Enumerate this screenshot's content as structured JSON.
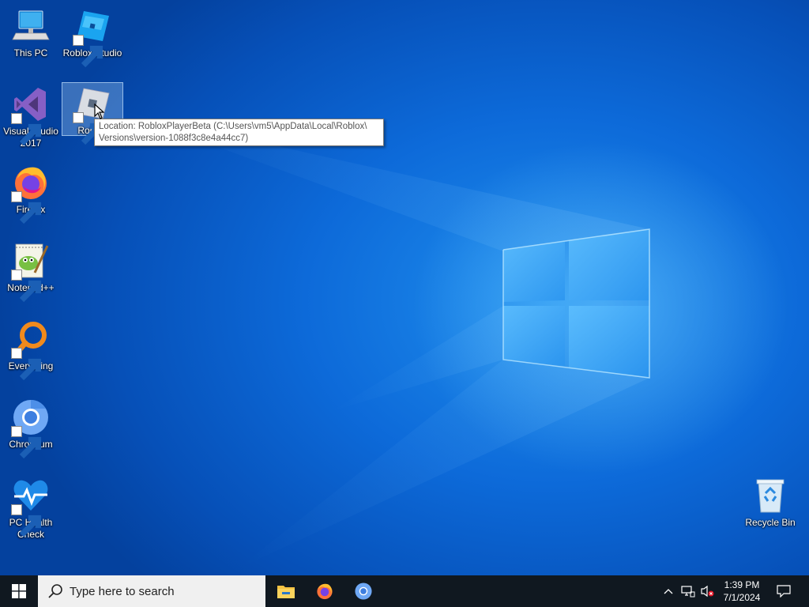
{
  "desktop": {
    "icons": [
      {
        "label": "This PC"
      },
      {
        "label": "Roblox Studio"
      },
      {
        "label": "Visual Studio 2017"
      },
      {
        "label": "Roblox"
      },
      {
        "label": "Firefox"
      },
      {
        "label": "Notepad++"
      },
      {
        "label": "Everything"
      },
      {
        "label": "Chromium"
      },
      {
        "label": "PC Health Check"
      },
      {
        "label": "Recycle Bin"
      }
    ]
  },
  "tooltip": {
    "line1": "Location: RobloxPlayerBeta (C:\\Users\\vm5\\AppData\\Local\\Roblox\\",
    "line2": "Versions\\version-1088f3c8e4a44cc7)"
  },
  "taskbar": {
    "search_placeholder": "Type here to search",
    "apps": [
      "file-explorer",
      "firefox",
      "chromium"
    ],
    "clock": {
      "time": "1:39 PM",
      "date": "7/1/2024"
    }
  },
  "colors": {
    "taskbar": "#101820",
    "wallpaper": "#0d6ad9",
    "accent": "#4ab0ff"
  }
}
